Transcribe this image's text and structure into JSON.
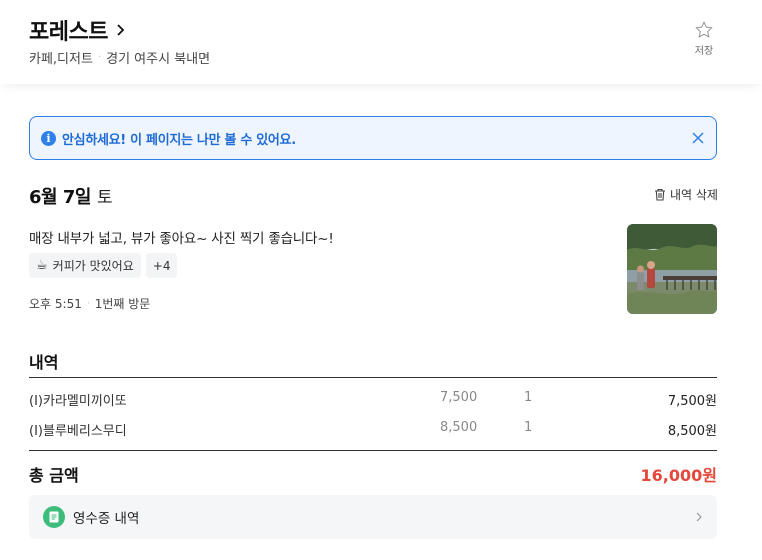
{
  "place": {
    "name": "포레스트",
    "category": "카페,디저트",
    "address": "경기 여주시 북내면",
    "save_label": "저장"
  },
  "notice": {
    "text": "안심하세요! 이 페이지는 나만 볼 수 있어요.",
    "color": "#2f7fe8"
  },
  "visit": {
    "date": "6월 7일",
    "weekday": "토",
    "delete_label": "내역 삭제",
    "review": "매장 내부가 넓고, 뷰가 좋아요~ 사진 찍기 좋습니다~!",
    "tag_emoji": "☕",
    "tag_label": "커피가 맛있어요",
    "tag_more": "+4",
    "time": "오후 5:51",
    "visit_count": "1번째 방문"
  },
  "order": {
    "title": "내역",
    "items": [
      {
        "name": "(I)카라멜미끼이또",
        "price": "7,500",
        "qty": "1",
        "amount": "7,500원"
      },
      {
        "name": "(I)블루베리스무디",
        "price": "8,500",
        "qty": "1",
        "amount": "8,500원"
      }
    ],
    "total_label": "총 금액",
    "total_value": "16,000원",
    "total_color": "#e5483b"
  },
  "receipt": {
    "label": "영수증 내역",
    "icon_color": "#3ebd7a"
  }
}
